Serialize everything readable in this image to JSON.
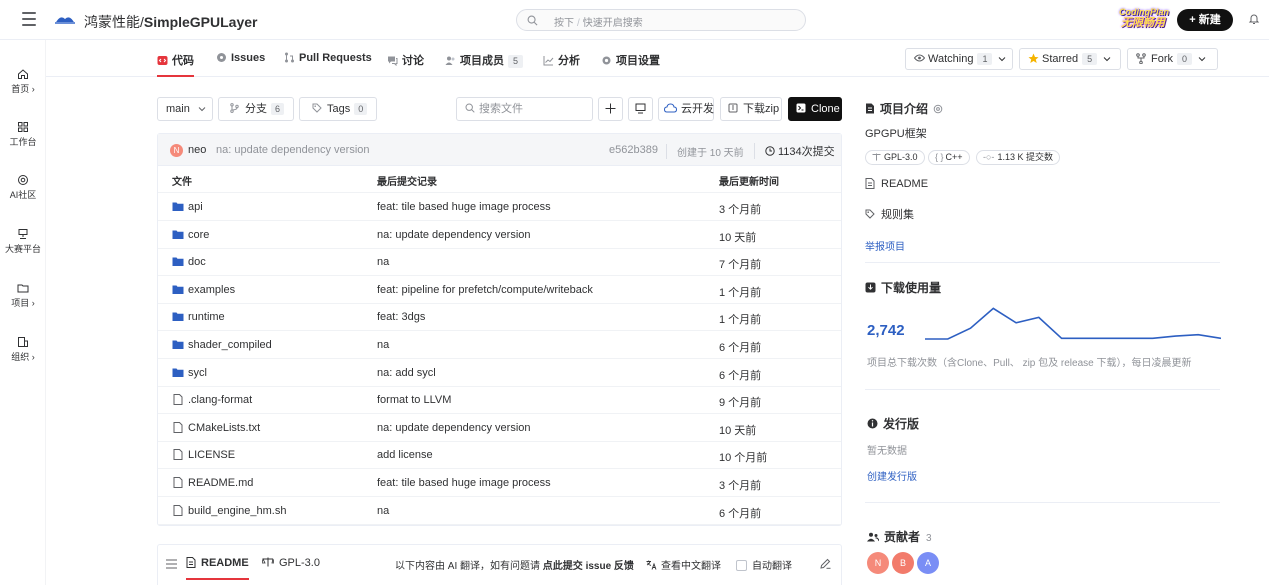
{
  "header": {
    "owner": "鸿蒙性能/",
    "repo": "SimpleGPULayer",
    "search_key": "按下",
    "search_slash": "/",
    "search_placeholder": "快速开启搜索",
    "promo_line1": "CodingPlan",
    "promo_line2": "无限畅用",
    "new_button": "+ 新建"
  },
  "sidenav": [
    {
      "label": "首页 ›",
      "icon": "home-icon"
    },
    {
      "label": "工作台",
      "icon": "grid-icon"
    },
    {
      "label": "AI社区",
      "icon": "ai-icon"
    },
    {
      "label": "大赛平台",
      "icon": "trophy-icon"
    },
    {
      "label": "项目 ›",
      "icon": "folder-icon"
    },
    {
      "label": "组织 ›",
      "icon": "organization-icon"
    }
  ],
  "tabs": [
    {
      "label": "代码",
      "icon": "code-icon"
    },
    {
      "label": "Issues",
      "icon": "issue-icon"
    },
    {
      "label": "Pull Requests",
      "icon": "pull-request-icon"
    },
    {
      "label": "讨论",
      "icon": "discussion-icon"
    },
    {
      "label": "项目成员",
      "icon": "members-icon",
      "badge": "5"
    },
    {
      "label": "分析",
      "icon": "analysis-icon"
    },
    {
      "label": "项目设置",
      "icon": "settings-icon"
    }
  ],
  "actions": {
    "watching": "Watching",
    "watching_count": "1",
    "starred": "Starred",
    "starred_count": "5",
    "fork": "Fork",
    "fork_count": "0"
  },
  "toolbar": {
    "branch": "main",
    "branches_label": "分支",
    "branches_count": "6",
    "tags_label": "Tags",
    "tags_count": "0",
    "search_placeholder": "搜索文件",
    "cloud_dev": "云开发",
    "download_zip": "下载zip",
    "clone": "Clone"
  },
  "commit": {
    "avatar": "N",
    "author": "neo",
    "message": "na: update dependency version",
    "hash": "e562b389",
    "time": "创建于 10 天前",
    "commits": "1134次提交"
  },
  "table": {
    "headers": [
      "文件",
      "最后提交记录",
      "最后更新时间"
    ],
    "rows": [
      {
        "name": "api",
        "type": "folder",
        "msg": "feat: tile based huge image process",
        "time": "3 个月前"
      },
      {
        "name": "core",
        "type": "folder",
        "msg": "na: update dependency version",
        "time": "10 天前"
      },
      {
        "name": "doc",
        "type": "folder",
        "msg": "na",
        "time": "7 个月前"
      },
      {
        "name": "examples",
        "type": "folder",
        "msg": "feat: pipeline for prefetch/compute/writeback",
        "time": "1 个月前"
      },
      {
        "name": "runtime",
        "type": "folder",
        "msg": "feat: 3dgs",
        "time": "1 个月前"
      },
      {
        "name": "shader_compiled",
        "type": "folder",
        "msg": "na",
        "time": "6 个月前"
      },
      {
        "name": "sycl",
        "type": "folder",
        "msg": "na: add sycl",
        "time": "6 个月前"
      },
      {
        "name": ".clang-format",
        "type": "file",
        "msg": "format to LLVM",
        "time": "9 个月前"
      },
      {
        "name": "CMakeLists.txt",
        "type": "file",
        "msg": "na: update dependency version",
        "time": "10 天前"
      },
      {
        "name": "LICENSE",
        "type": "file",
        "msg": "add license",
        "time": "10 个月前"
      },
      {
        "name": "README.md",
        "type": "file",
        "msg": "feat: tile based huge image process",
        "time": "3 个月前"
      },
      {
        "name": "build_engine_hm.sh",
        "type": "file",
        "msg": "na",
        "time": "6 个月前"
      }
    ]
  },
  "readme_bar": {
    "readme": "README",
    "license": "GPL-3.0",
    "notice_prefix": "以下内容由 AI 翻译，如有问题请 ",
    "notice_link": "点此提交 issue 反馈",
    "translate": "查看中文翻译",
    "auto_translate": "自动翻译"
  },
  "sidebar": {
    "intro_title": "项目介绍",
    "description": "GPGPU框架",
    "pills": [
      "GPL-3.0",
      "C++",
      "1.13 K 提交数"
    ],
    "readme": "README",
    "rules": "规则集",
    "report": "举报项目",
    "downloads_title": "下载使用量",
    "downloads_count": "2,742",
    "downloads_note": "项目总下载次数（含Clone、Pull、 zip 包及 release 下载），每日凌晨更新",
    "releases_title": "发行版",
    "releases_empty": "暂无数据",
    "create_release": "创建发行版",
    "contributors_title": "贡献者",
    "contributors_count": "3",
    "contributors": [
      {
        "initial": "N",
        "color": "#f58a7a"
      },
      {
        "initial": "B",
        "color": "#f27b6b"
      },
      {
        "initial": "A",
        "color": "#7a8ef5"
      }
    ]
  },
  "chart_data": {
    "type": "line",
    "title": "",
    "values": [
      0,
      0,
      0.3,
      0.85,
      0.45,
      0.6,
      0.02,
      0.02,
      0.02,
      0.02,
      0.02,
      0.08,
      0.12,
      0.02
    ],
    "ylim": [
      0,
      1
    ],
    "grid": false,
    "legend": "none",
    "color": "#2d5fc2"
  }
}
